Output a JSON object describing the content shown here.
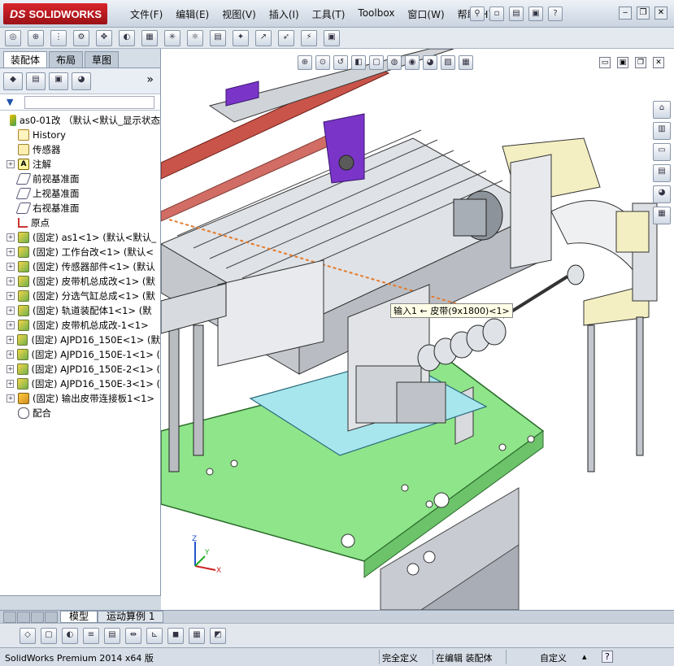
{
  "app": {
    "logo_prefix": "DS",
    "logo_text": "SOLIDWORKS",
    "menu": [
      "文件(F)",
      "编辑(E)",
      "视图(V)",
      "插入(I)",
      "工具(T)",
      "Toolbox",
      "窗口(W)",
      "帮助(H)"
    ],
    "help_label": "?"
  },
  "left_panel": {
    "tabs": [
      "装配体",
      "布局",
      "草图"
    ],
    "active_tab": 0,
    "tree": [
      {
        "label": "as0-01改 （默认<默认_显示状态",
        "icon": "assembly-icon",
        "expander": "",
        "indent": 0,
        "kind": "asm"
      },
      {
        "label": "History",
        "icon": "history-icon",
        "expander": "",
        "indent": 1,
        "kind": "hist"
      },
      {
        "label": "传感器",
        "icon": "sensor-icon",
        "expander": "",
        "indent": 1,
        "kind": "sens"
      },
      {
        "label": "注解",
        "icon": "annotation-icon",
        "expander": "+",
        "indent": 1,
        "kind": "note",
        "glyph": "A"
      },
      {
        "label": "前视基准面",
        "icon": "plane-icon",
        "expander": "",
        "indent": 1,
        "kind": "plane"
      },
      {
        "label": "上视基准面",
        "icon": "plane-icon",
        "expander": "",
        "indent": 1,
        "kind": "plane"
      },
      {
        "label": "右视基准面",
        "icon": "plane-icon",
        "expander": "",
        "indent": 1,
        "kind": "plane"
      },
      {
        "label": "原点",
        "icon": "origin-icon",
        "expander": "",
        "indent": 1,
        "kind": "origin"
      },
      {
        "label": "(固定) as1<1> (默认<默认_",
        "icon": "component-icon",
        "expander": "+",
        "indent": 1,
        "kind": "comp"
      },
      {
        "label": "(固定) 工作台改<1> (默认<",
        "icon": "component-icon",
        "expander": "+",
        "indent": 1,
        "kind": "comp"
      },
      {
        "label": "(固定) 传感器部件<1> (默认",
        "icon": "component-icon",
        "expander": "+",
        "indent": 1,
        "kind": "comp"
      },
      {
        "label": "(固定) 皮带机总成改<1> (默",
        "icon": "component-icon",
        "expander": "+",
        "indent": 1,
        "kind": "comp"
      },
      {
        "label": "(固定) 分选气缸总成<1> (默",
        "icon": "component-icon",
        "expander": "+",
        "indent": 1,
        "kind": "comp"
      },
      {
        "label": "(固定) 轨道装配体1<1> (默",
        "icon": "component-icon",
        "expander": "+",
        "indent": 1,
        "kind": "comp"
      },
      {
        "label": "(固定) 皮带机总成改-1<1>",
        "icon": "component-icon",
        "expander": "+",
        "indent": 1,
        "kind": "comp"
      },
      {
        "label": "(固定) AJPD16_150E<1> (默",
        "icon": "component-icon",
        "expander": "+",
        "indent": 1,
        "kind": "comp"
      },
      {
        "label": "(固定) AJPD16_150E-1<1> (",
        "icon": "component-icon",
        "expander": "+",
        "indent": 1,
        "kind": "comp"
      },
      {
        "label": "(固定) AJPD16_150E-2<1> (",
        "icon": "component-icon",
        "expander": "+",
        "indent": 1,
        "kind": "comp"
      },
      {
        "label": "(固定) AJPD16_150E-3<1> (",
        "icon": "component-icon",
        "expander": "+",
        "indent": 1,
        "kind": "comp"
      },
      {
        "label": "(固定) 输出皮带连接板1<1>",
        "icon": "part-icon",
        "expander": "+",
        "indent": 1,
        "kind": "comp2"
      },
      {
        "label": "配合",
        "icon": "mates-icon",
        "expander": "",
        "indent": 1,
        "kind": "mate"
      }
    ]
  },
  "viewport": {
    "tooltip": "输入1 ← 皮带(9x1800)<1>",
    "triad": {
      "x": "X",
      "y": "Y",
      "z": "Z"
    },
    "colors": {
      "bed_green": "#8fe58a",
      "plate_cyan": "#a8e6ee",
      "frame_gray": "#c8ccd2",
      "belt_red": "#c9544a",
      "purple": "#7a35c8",
      "cream": "#f4efc2"
    }
  },
  "bottom_tabs": [
    "模型",
    "运动算例 1"
  ],
  "active_bottom_tab": 0,
  "status": {
    "product": "SolidWorks Premium 2014 x64 版",
    "state1": "完全定义",
    "state2": "在编辑 装配体",
    "custom": "自定义",
    "help": "?"
  }
}
